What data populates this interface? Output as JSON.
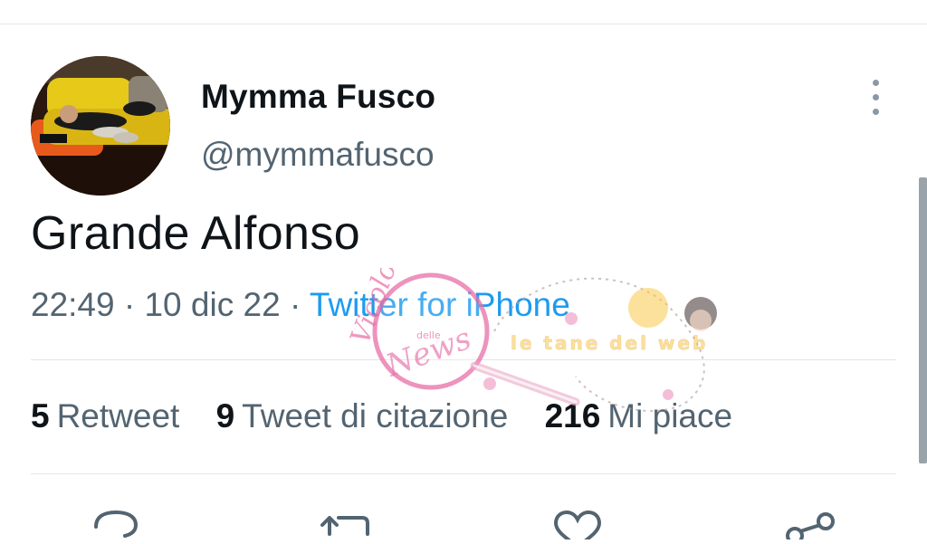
{
  "tweet": {
    "author": {
      "display_name": "Mymma Fusco",
      "handle": "@mymmafusco",
      "avatar_icon": "profile-photo"
    },
    "text": "Grande Alfonso",
    "time": "22:49",
    "separator": "·",
    "date": "10 dic 22",
    "source": "Twitter for iPhone",
    "more_icon": "vertical-ellipsis-icon"
  },
  "stats": [
    {
      "count": "5",
      "label": "Retweet"
    },
    {
      "count": "9",
      "label": "Tweet di citazione"
    },
    {
      "count": "216",
      "label": "Mi piace"
    }
  ],
  "actions": [
    {
      "icon": "reply-icon"
    },
    {
      "icon": "retweet-icon"
    },
    {
      "icon": "like-icon"
    },
    {
      "icon": "share-icon"
    }
  ],
  "watermark": {
    "line1": "Vicolo",
    "line2": "delle",
    "line3": "News",
    "tagline": "le tane del web"
  },
  "colors": {
    "text_primary": "#0f1419",
    "text_secondary": "#536471",
    "link": "#1d9bf0",
    "divider": "#e3e6e8",
    "watermark_pink": "#e86fa8",
    "watermark_yellow": "#f7c948"
  }
}
